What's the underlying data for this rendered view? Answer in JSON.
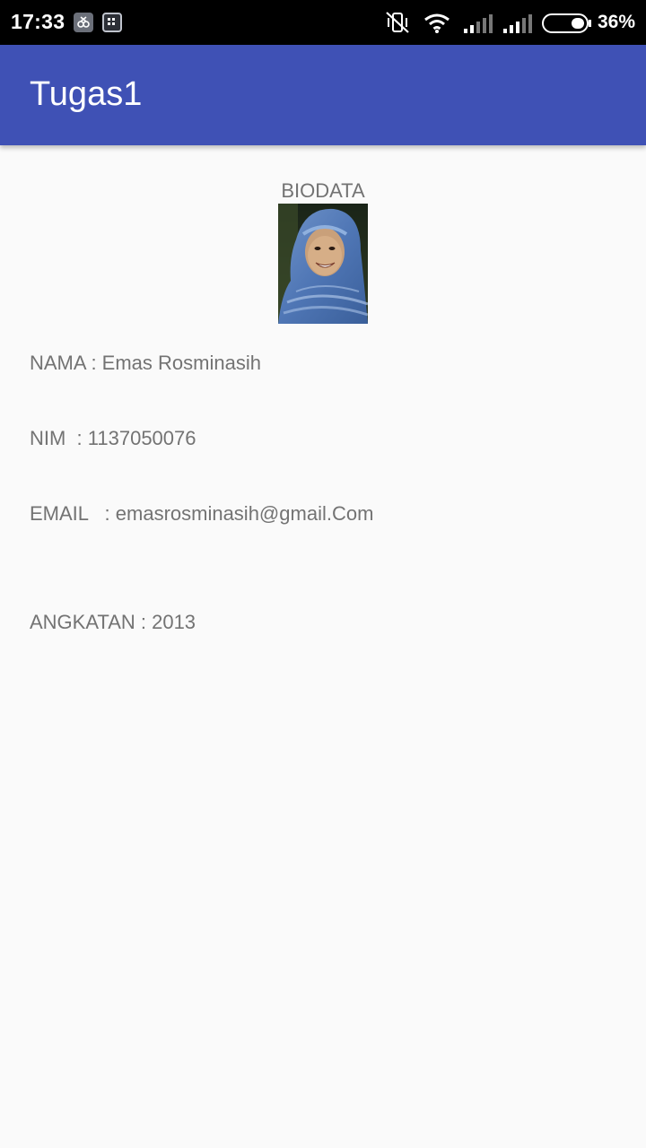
{
  "status_bar": {
    "time": "17:33",
    "battery_percent": "36%",
    "icons": [
      "clipboard-notification-icon",
      "bbm-notification-icon",
      "vibrate-off-icon",
      "wifi-icon",
      "signal-1-icon",
      "signal-2-icon",
      "battery-icon"
    ]
  },
  "app_bar": {
    "title": "Tugas1",
    "color": "#3f51b5"
  },
  "content": {
    "heading": "BIODATA",
    "photo_alt": "profile-photo",
    "fields": [
      {
        "text": "NAMA : Emas Rosminasih"
      },
      {
        "text": "NIM  : 1137050076"
      },
      {
        "text": "EMAIL   : emasrosminasih@gmail.Com"
      },
      {
        "text": "ANGKATAN : 2013"
      }
    ]
  }
}
